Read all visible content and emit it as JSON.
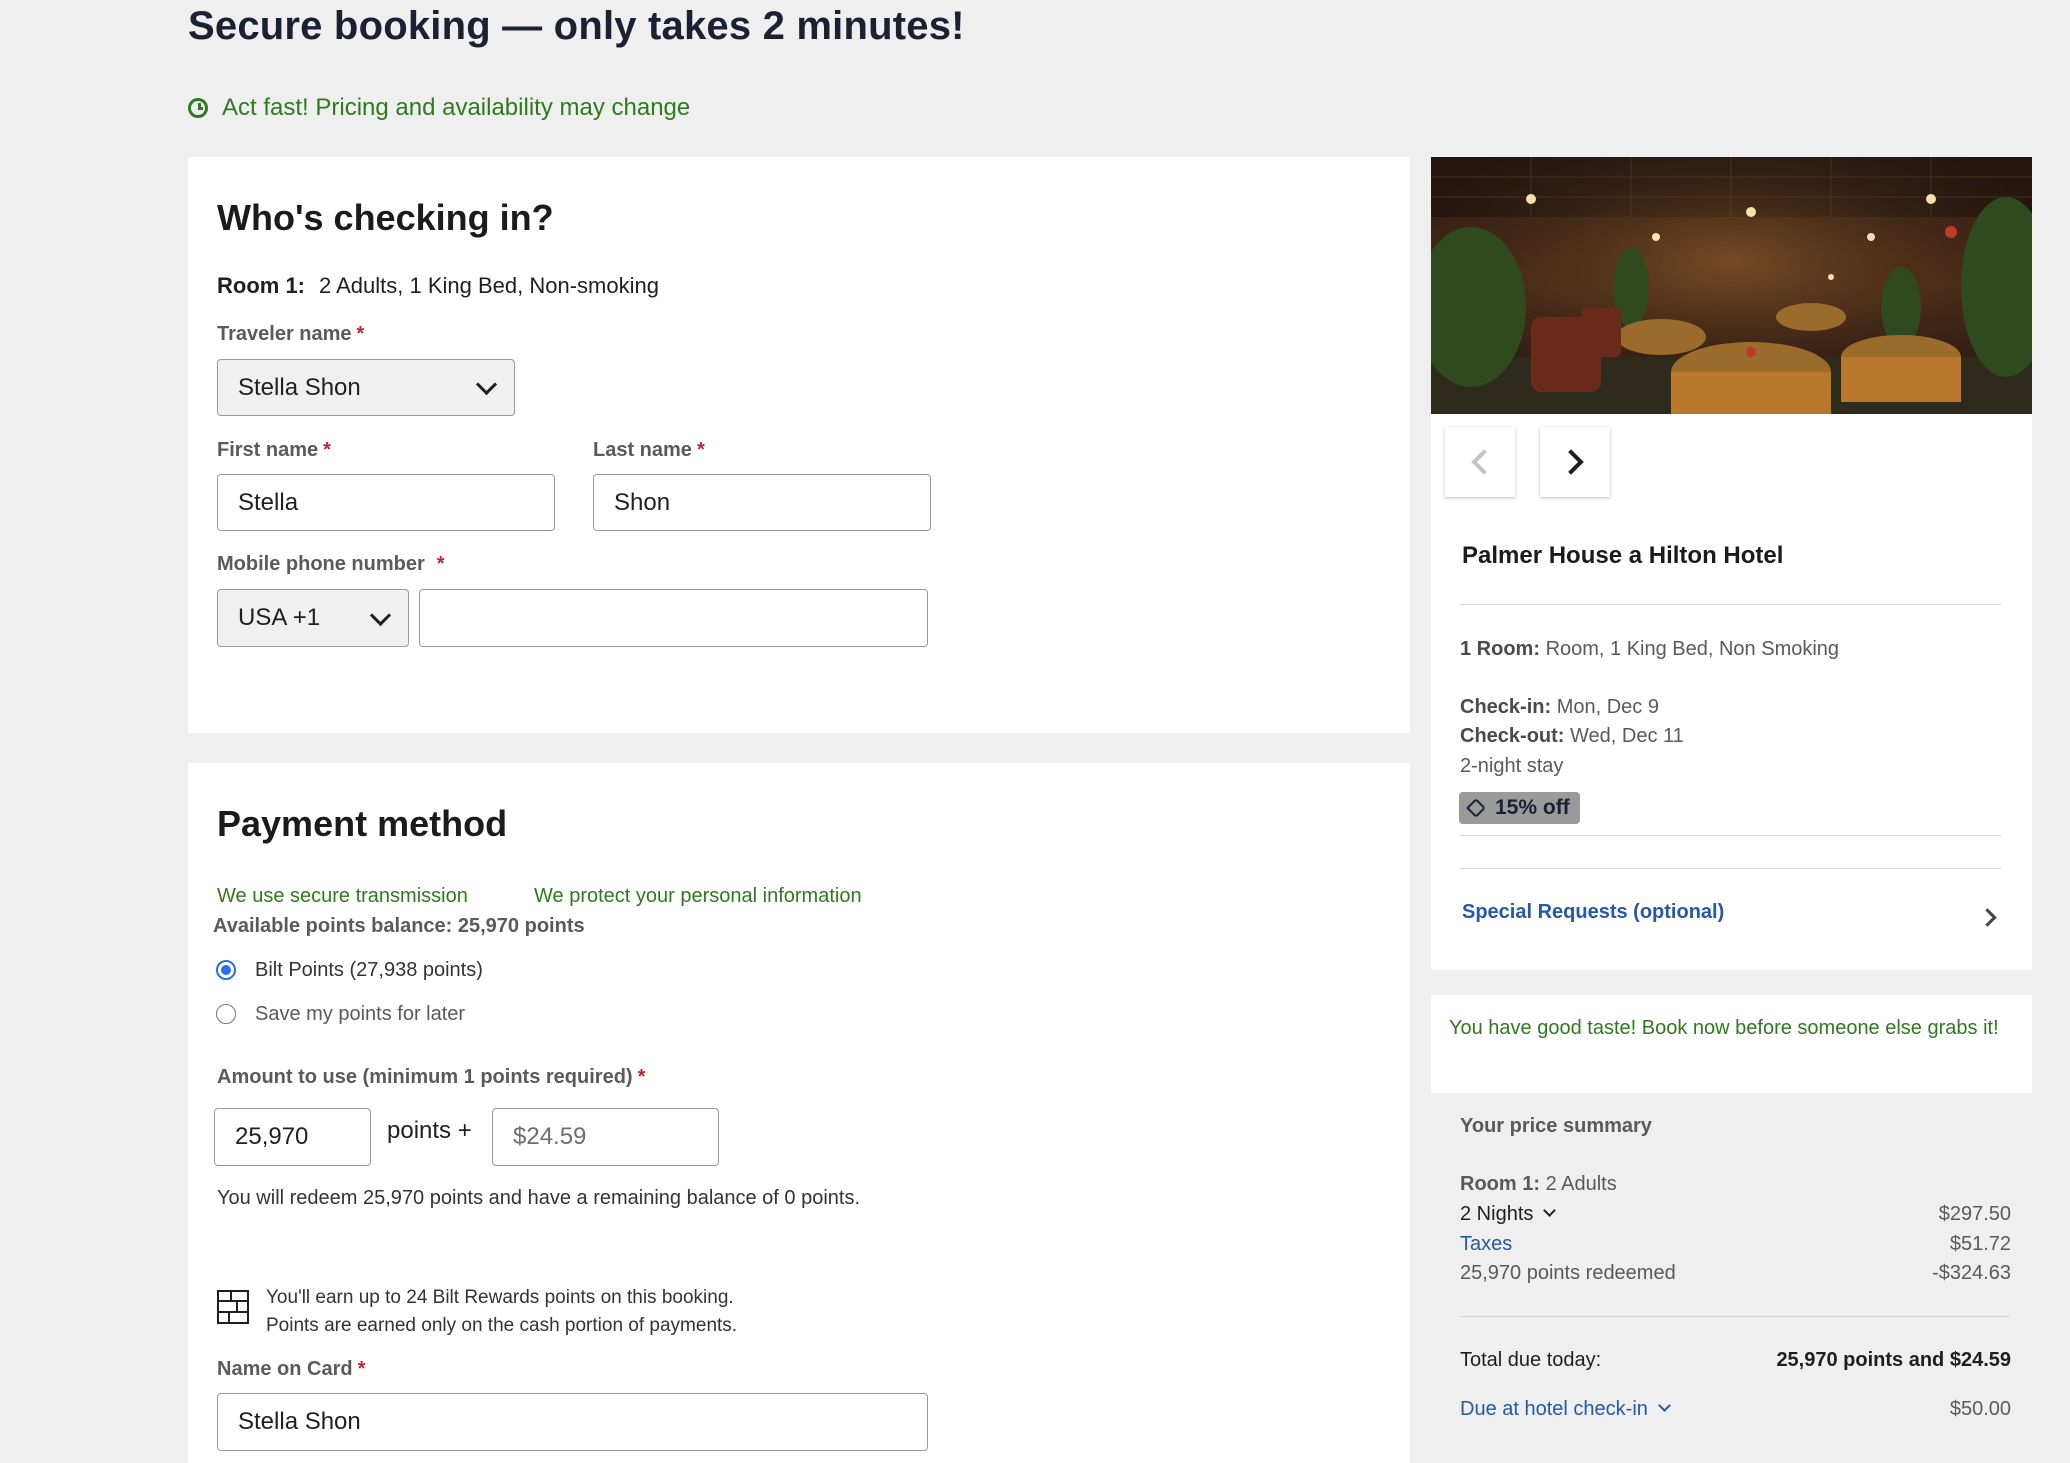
{
  "header": {
    "title": "Secure booking — only takes 2 minutes!",
    "urgency": "Act fast! Pricing and availability may change"
  },
  "checkin": {
    "heading": "Who's checking in?",
    "room_label": "Room 1:",
    "room_desc": "2 Adults, 1 King Bed, Non-smoking",
    "traveler_label": "Traveler name",
    "traveler_value": "Stella Shon",
    "first_label": "First name",
    "first_value": "Stella",
    "last_label": "Last name",
    "last_value": "Shon",
    "phone_label": "Mobile phone number",
    "country_value": "USA +1",
    "phone_value": "",
    "required_mark": "*"
  },
  "payment": {
    "heading": "Payment method",
    "secure_note": "We use secure transmission",
    "protect_note": "We protect your personal information",
    "balance": "Available points balance: 25,970 points",
    "option_bilt": "Bilt Points (27,938 points)",
    "option_save": "Save my points for later",
    "amount_label": "Amount to use (minimum 1 points required)",
    "points_value": "25,970",
    "points_plus": "points +",
    "cash_value": "$24.59",
    "redeem_note": "You will redeem 25,970 points and have a remaining balance of 0 points.",
    "earn_line1": "You'll earn up to 24 Bilt Rewards points on this booking.",
    "earn_line2": "Points are earned only on the cash portion of payments.",
    "card_name_label": "Name on Card",
    "card_name_value": "Stella Shon"
  },
  "hotel": {
    "name": "Palmer House a Hilton Hotel",
    "room_label": "1 Room:",
    "room_value": "Room, 1 King Bed, Non Smoking",
    "checkin_label": "Check-in:",
    "checkin_value": "Mon, Dec 9",
    "checkout_label": "Check-out:",
    "checkout_value": "Wed, Dec 11",
    "stay": "2-night stay",
    "discount": "15% off",
    "special_requests": "Special Requests (optional)"
  },
  "good_taste": "You have good taste! Book now before someone else grabs it!",
  "summary": {
    "heading": "Your price summary",
    "room_label": "Room 1:",
    "room_value": "2 Adults",
    "nights_label": "2 Nights",
    "nights_value": "$297.50",
    "taxes_label": "Taxes",
    "taxes_value": "$51.72",
    "points_label": "25,970 points redeemed",
    "points_value": "-$324.63",
    "total_label": "Total due today:",
    "total_value": "25,970 points and $24.59",
    "due_label": "Due at hotel check-in",
    "due_value": "$50.00"
  }
}
